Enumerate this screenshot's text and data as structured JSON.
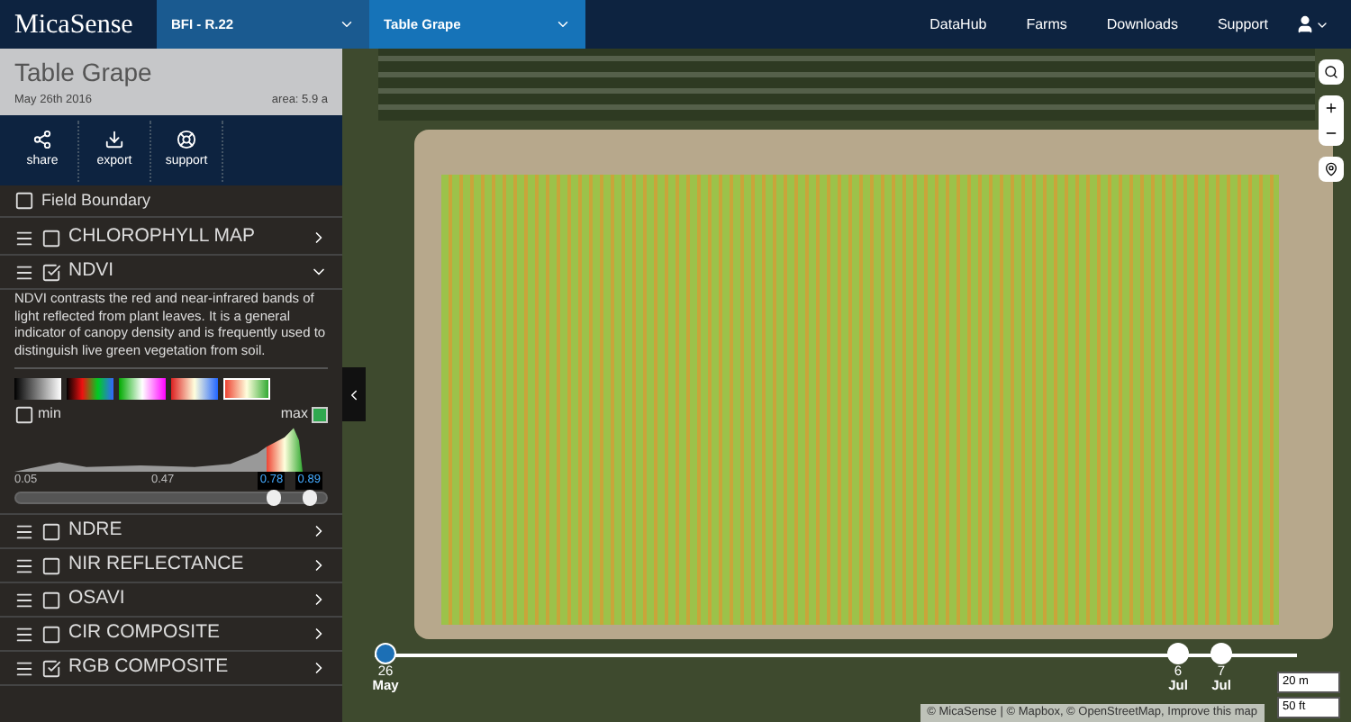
{
  "header": {
    "logo": "MicaSense",
    "selectors": [
      {
        "label": "BFI - R.22"
      },
      {
        "label": "Table Grape"
      }
    ],
    "nav": [
      "DataHub",
      "Farms",
      "Downloads",
      "Support"
    ]
  },
  "field": {
    "title": "Table Grape",
    "date": "May 26th 2016",
    "area": "area: 5.9 a"
  },
  "actions": [
    "share",
    "export",
    "support"
  ],
  "field_boundary": {
    "label": "Field Boundary",
    "checked": false
  },
  "layers": [
    {
      "label": "CHLOROPHYLL MAP",
      "checked": false,
      "expanded": false
    },
    {
      "label": "NDVI",
      "checked": true,
      "expanded": true,
      "description": "NDVI contrasts the red and near-infrared bands of light reflected from plant leaves. It is a general indicator of canopy density and is frequently used to distinguish live green vegetation from soil.",
      "palettes": [
        {
          "selected": false
        },
        {
          "selected": false
        },
        {
          "selected": false
        },
        {
          "selected": false
        },
        {
          "selected": true
        }
      ],
      "min": {
        "label": "min",
        "checked": false
      },
      "max": {
        "label": "max",
        "checked": true
      },
      "ticks": [
        "0.05",
        "0.47"
      ],
      "handles": [
        {
          "label": "0.78",
          "level": 0.83
        },
        {
          "label": "0.89",
          "level": 0.95
        }
      ]
    },
    {
      "label": "NDRE",
      "checked": false,
      "expanded": false
    },
    {
      "label": "NIR REFLECTANCE",
      "checked": false,
      "expanded": false
    },
    {
      "label": "OSAVI",
      "checked": false,
      "expanded": false
    },
    {
      "label": "CIR COMPOSITE",
      "checked": false,
      "expanded": false
    },
    {
      "label": "RGB COMPOSITE",
      "checked": true,
      "expanded": false
    }
  ],
  "timeline": [
    {
      "day": "26",
      "month": "May",
      "selected": true
    },
    {
      "day": "6",
      "month": "Jul",
      "selected": false
    },
    {
      "day": "7",
      "month": "Jul",
      "selected": false
    }
  ],
  "scale": [
    "20 m",
    "50 ft"
  ],
  "attribution": "© MicaSense | © Mapbox, © OpenStreetMap, Improve this map"
}
